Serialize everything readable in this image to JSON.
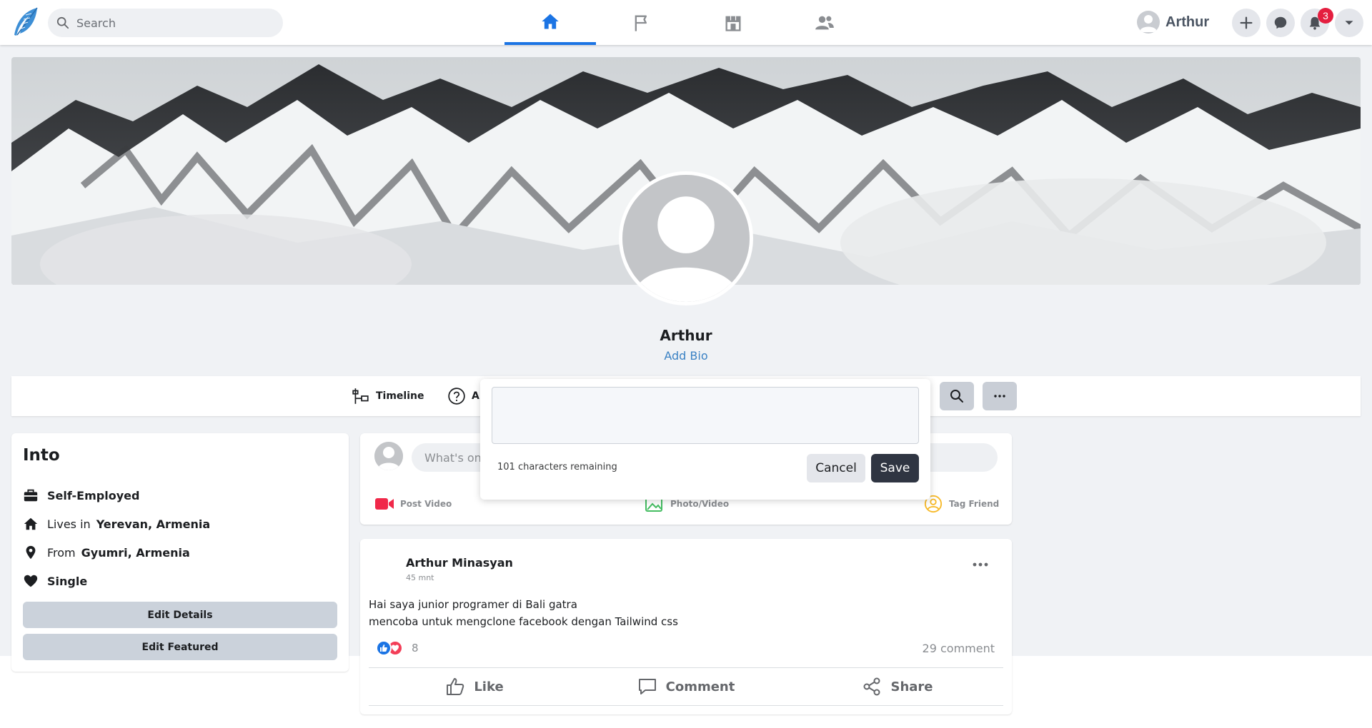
{
  "topbar": {
    "search_placeholder": "Search",
    "user_name": "Arthur",
    "notification_count": "3",
    "accent": "#1b74e4"
  },
  "profile": {
    "name": "Arthur",
    "add_bio": "Add Bio"
  },
  "profile_tabs": {
    "timeline": "Timeline",
    "about_partial": "Al"
  },
  "intro": {
    "title": "Into",
    "work": "Self-Employed",
    "lives_label": "Lives in",
    "lives_value": "Yerevan, Armenia",
    "from_label": "From",
    "from_value": "Gyumri, Armenia",
    "relationship": "Single",
    "edit_details": "Edit Details",
    "edit_featured": "Edit Featured"
  },
  "create_post": {
    "placeholder_partial": "What's on",
    "post_video": "Post Video",
    "photo_video": "Photo/Video",
    "tag_friend": "Tag Friend"
  },
  "post": {
    "author": "Arthur Minasyan",
    "time": "45 mnt",
    "line1": "Hai saya junior programer di Bali gatra",
    "line2": "mencoba untuk mengclone facebook dengan Tailwind css",
    "reaction_count": "8",
    "comment_count": "29 comment",
    "like": "Like",
    "comment": "Comment",
    "share": "Share"
  },
  "bio_editor": {
    "chars_remaining": "101 characters remaining",
    "cancel": "Cancel",
    "save": "Save"
  }
}
